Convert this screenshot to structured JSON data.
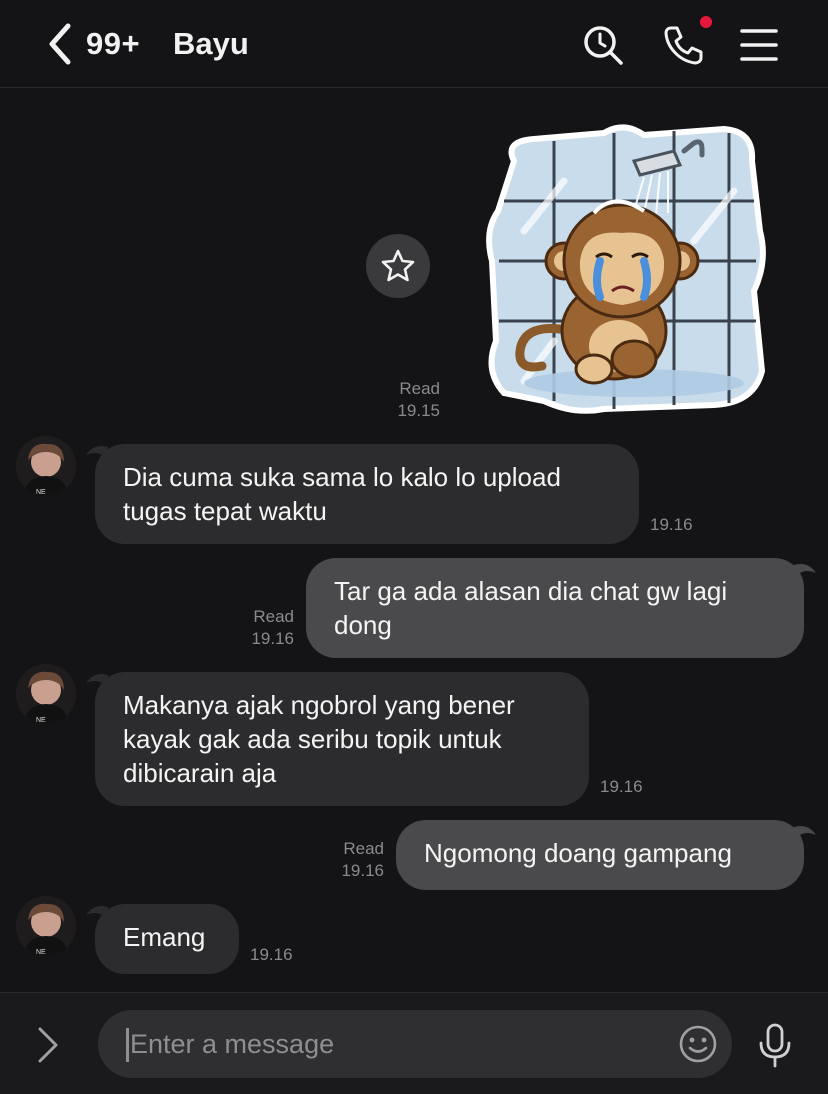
{
  "header": {
    "unread_count": "99+",
    "contact_name": "Bayu",
    "icons": [
      "chevron-left-icon",
      "search-icon",
      "phone-icon",
      "menu-icon"
    ],
    "notification_dot_color": "#e5183b"
  },
  "messages": [
    {
      "type": "sticker",
      "direction": "out",
      "status": "Read",
      "time": "19.15"
    },
    {
      "direction": "in",
      "text_lines": [
        "Dia cuma suka sama lo kalo lo upload",
        "tugas tepat waktu"
      ],
      "time": "19.16"
    },
    {
      "direction": "out",
      "text_lines": [
        "Tar ga ada alasan dia chat gw lagi",
        "dong"
      ],
      "status": "Read",
      "time": "19.16"
    },
    {
      "direction": "in",
      "text_lines": [
        "Makanya ajak ngobrol yang bener",
        "kayak gak ada seribu topik untuk",
        "dibicarain aja"
      ],
      "time": "19.16"
    },
    {
      "direction": "out",
      "text_lines": [
        "Ngomong doang gampang"
      ],
      "status": "Read",
      "time": "19.16"
    },
    {
      "direction": "in",
      "text_lines": [
        "Emang"
      ],
      "time": "19.16"
    }
  ],
  "composer": {
    "placeholder": "Enter a message",
    "icons": [
      "chevron-right-icon",
      "emoji-icon",
      "microphone-icon"
    ]
  },
  "colors": {
    "background": "#141416",
    "incoming_bubble": "#2c2c2e",
    "outgoing_bubble": "#4a4a4c",
    "meta_text": "#8a8a8e"
  }
}
